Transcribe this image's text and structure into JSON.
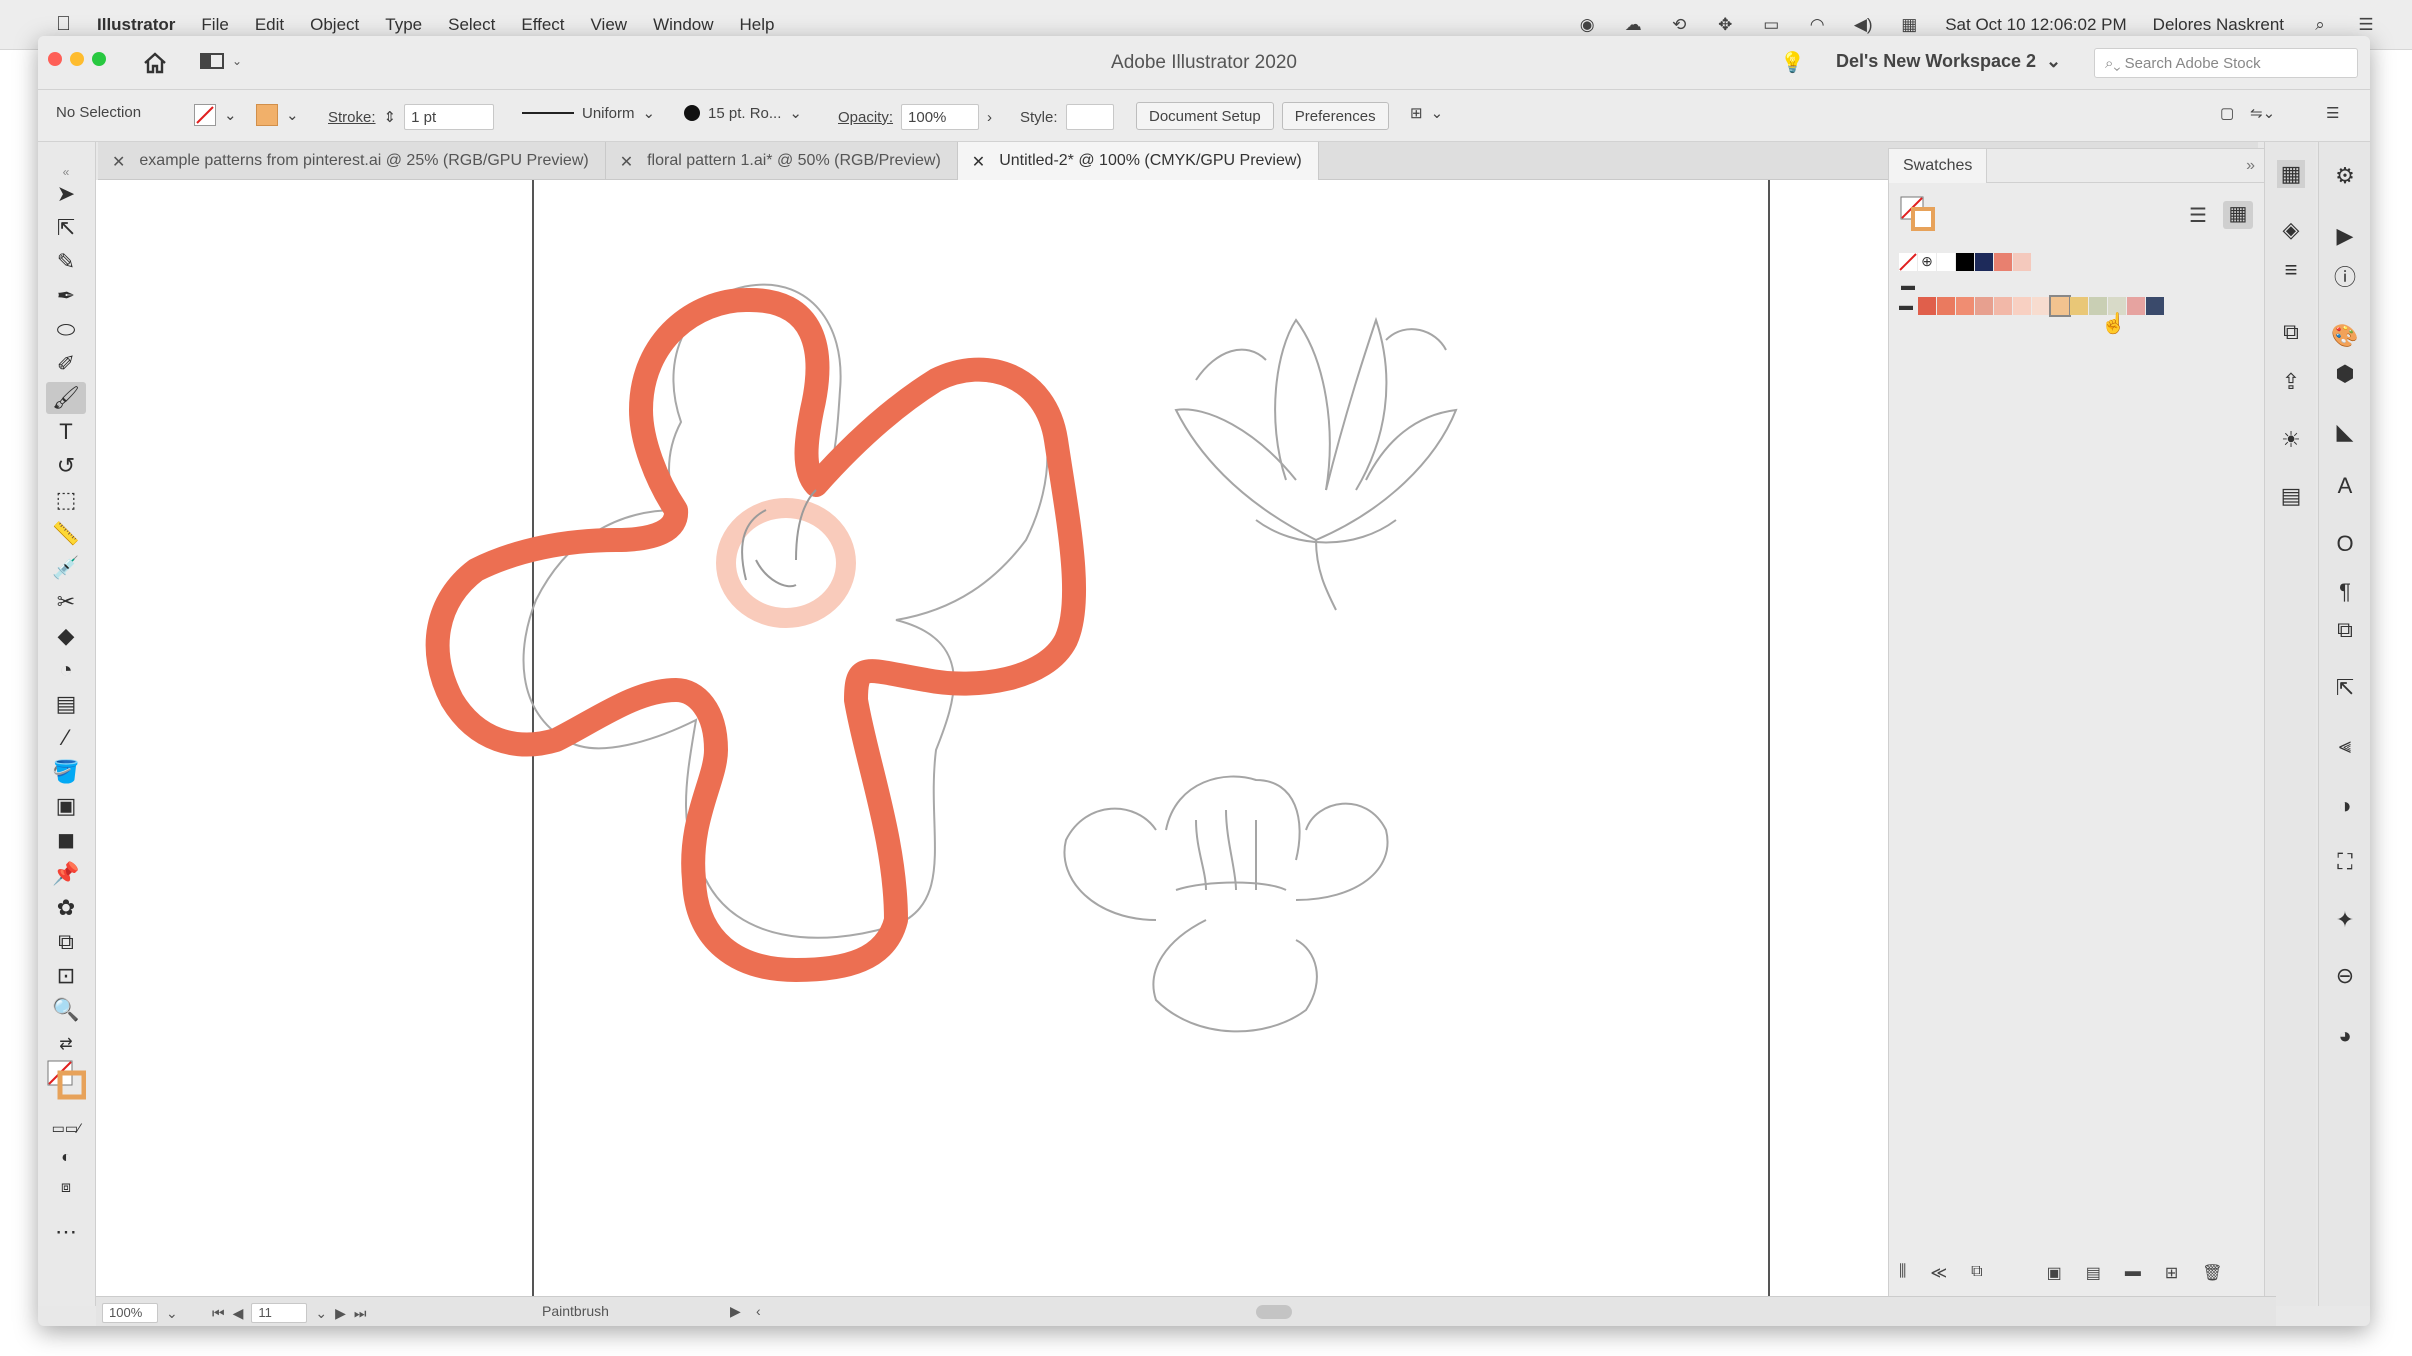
{
  "menubar": {
    "apple": "",
    "app": "Illustrator",
    "items": [
      "File",
      "Edit",
      "Object",
      "Type",
      "Select",
      "Effect",
      "View",
      "Window",
      "Help"
    ],
    "clock": "Sat Oct 10  12:06:02 PM",
    "user": "Delores Naskrent"
  },
  "window": {
    "title": "Adobe Illustrator 2020",
    "workspace": "Del's New Workspace 2",
    "search_placeholder": "Search Adobe Stock"
  },
  "control": {
    "selection": "No Selection",
    "stroke_label": "Stroke:",
    "stroke_value": "1 pt",
    "profile": "Uniform",
    "brush": "15 pt. Ro...",
    "opacity_label": "Opacity:",
    "opacity_value": "100%",
    "style_label": "Style:",
    "document_setup": "Document Setup",
    "preferences": "Preferences"
  },
  "tabs": [
    {
      "label": "example patterns from pinterest.ai @ 25% (RGB/GPU Preview)"
    },
    {
      "label": "floral pattern 1.ai* @ 50% (RGB/Preview)"
    },
    {
      "label": "Untitled-2* @ 100% (CMYK/GPU Preview)"
    }
  ],
  "status": {
    "zoom": "100%",
    "artboard": "11",
    "tool": "Paintbrush"
  },
  "swatches": {
    "title": "Swatches",
    "row1": [
      "#ffffff",
      "#000000",
      "#1d2a5a",
      "#e8806f",
      "#f4c9bd"
    ],
    "group": [
      "#e05f4b",
      "#ea7a5f",
      "#f08d72",
      "#e7a08f",
      "#f2b8a8",
      "#f8d0c2",
      "#f7dccf",
      "#f2c38f",
      "#e9c777",
      "#c9cfb4",
      "#d8dac8",
      "#e6a3a0",
      "#3a4a6b"
    ]
  },
  "colors": {
    "accent_stroke": "#ec6f52",
    "light_stroke": "#f9cbbb",
    "sketch": "#9a9a9a"
  }
}
